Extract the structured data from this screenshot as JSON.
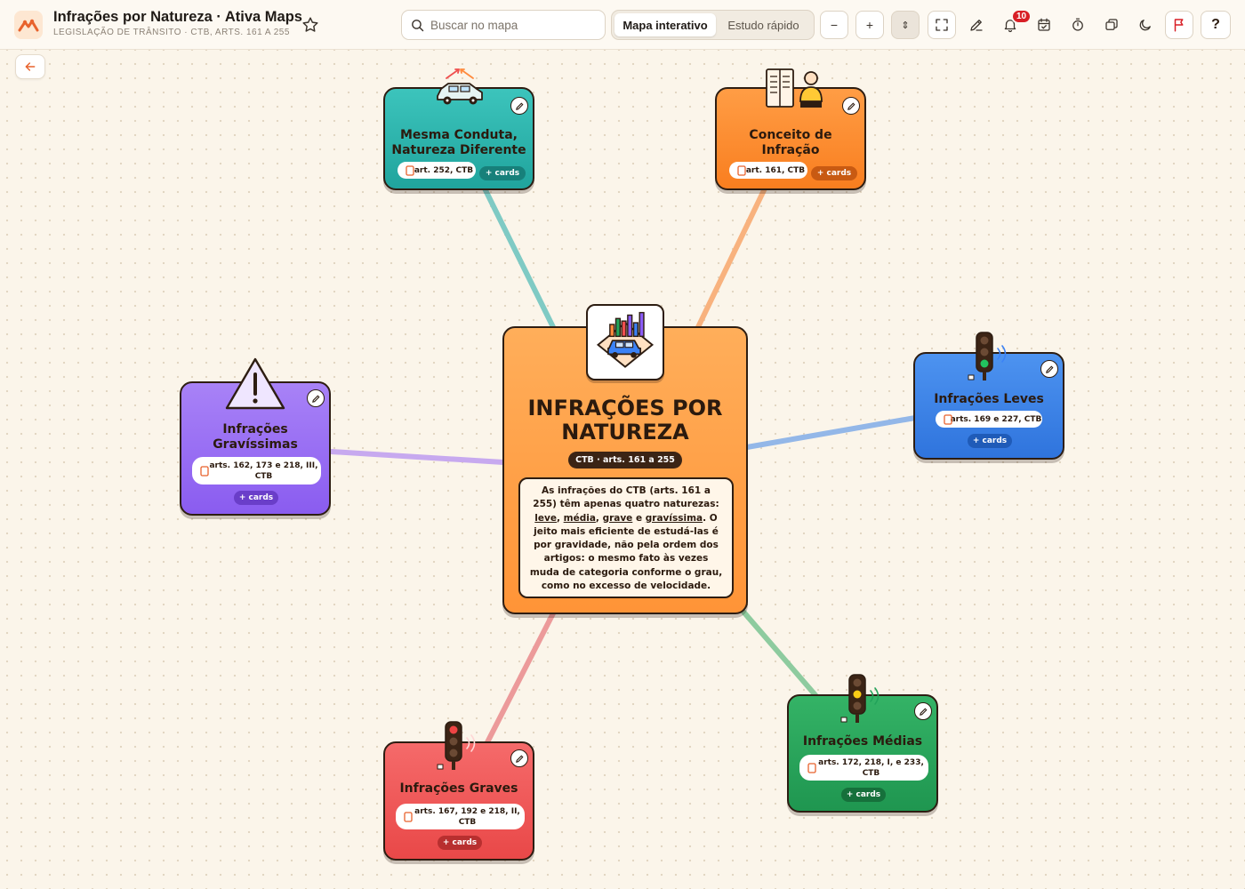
{
  "header": {
    "title": "Infrações por Natureza · Ativa Maps",
    "subtitle": "LEGISLAÇÃO DE TRÂNSITO · CTB, ARTS. 161 A 255",
    "logo_icon": "ativa-maps-logo-icon",
    "star_icon": "star-icon"
  },
  "search": {
    "placeholder": "Buscar no mapa",
    "value": ""
  },
  "modes": {
    "active": "Mapa interativo",
    "inactive": "Estudo rápido"
  },
  "toolbar": {
    "zoom_out": "−",
    "zoom_in": "+",
    "fit": "⇕",
    "notifications_count": "10",
    "help": "?",
    "icons": [
      "fullscreen-icon",
      "pen-icon",
      "bell-icon",
      "calendar-icon",
      "timer-icon",
      "cards-stack-icon",
      "moon-icon",
      "flag-icon"
    ]
  },
  "colors": {
    "accent": "#e8622c",
    "teal": "#2bb3ac",
    "orange": "#fb923c",
    "blue": "#3b82f6",
    "purple": "#8b5cf6",
    "green": "#22a35a",
    "red": "#ef4f4f"
  },
  "central": {
    "title_line1": "INFRAÇÕES POR",
    "title_line2": "NATUREZA",
    "tag": "CTB · arts. 161 a 255",
    "desc_a": "As infrações do CTB (arts. 161 a 255) têm apenas quatro naturezas: ",
    "word_leve": "leve",
    "comma1": ", ",
    "word_media": "média",
    "comma2": ", ",
    "word_grave": "grave",
    "and": " e ",
    "word_gravissima": "gravíssima",
    "desc_b": ". O jeito mais eficiente de estudá-las é por gravidade, não pela ordem dos artigos: o mesmo fato às vezes muda de categoria conforme o grau, como no excesso de velocidade."
  },
  "nodes": {
    "mesma_conduta": {
      "title_l1": "Mesma Conduta,",
      "title_l2": "Natureza Diferente",
      "ref": "art. 252, CTB",
      "cards": "+ cards"
    },
    "conceito": {
      "title_l1": "Conceito de",
      "title_l2": "Infração",
      "ref": "art. 161, CTB",
      "cards": "+ cards"
    },
    "leves": {
      "title": "Infrações Leves",
      "ref": "arts. 169 e 227, CTB",
      "cards": "+ cards"
    },
    "gravissimas": {
      "title_l1": "Infrações",
      "title_l2": "Gravíssimas",
      "ref_l1": "arts. 162, 173 e 218, III,",
      "ref_l2": "CTB",
      "cards": "+ cards"
    },
    "graves": {
      "title": "Infrações Graves",
      "ref_l1": "arts. 167, 192 e 218, II,",
      "ref_l2": "CTB",
      "cards": "+ cards"
    },
    "medias": {
      "title": "Infrações Médias",
      "ref_l1": "arts. 172, 218, I, e 233,",
      "ref_l2": "CTB",
      "cards": "+ cards"
    }
  }
}
